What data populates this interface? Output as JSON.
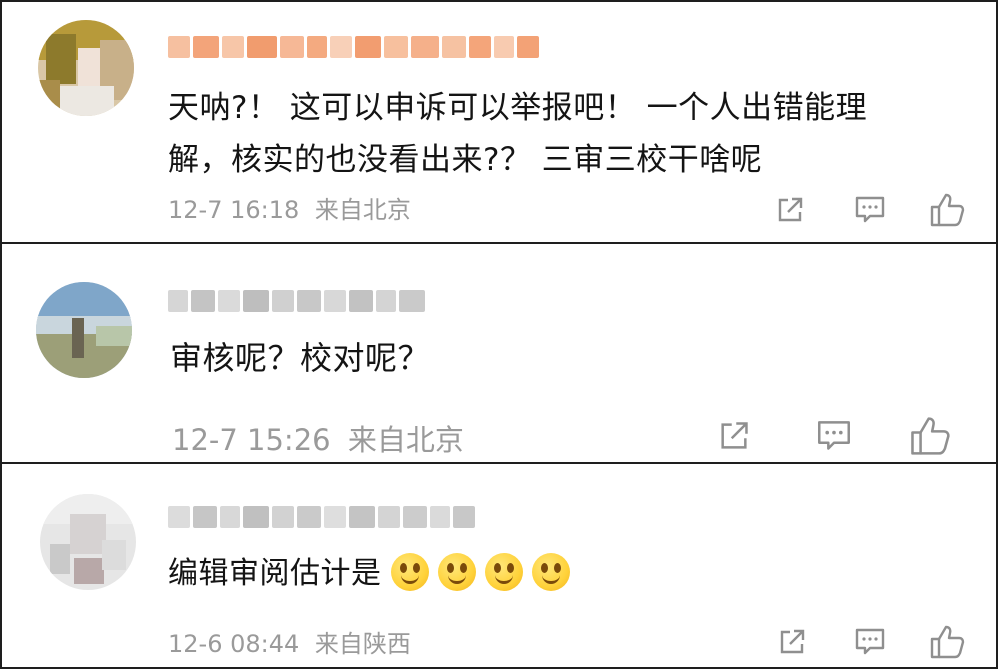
{
  "comments": [
    {
      "text_line1": "天呐?！ 这可以申诉可以举报吧！ 一个人出错能理",
      "text_line2": "解，核实的也没看出来?？ 三审三校干啥呢",
      "time": "12-7 16:18",
      "location": "来自北京",
      "username_style": "orange"
    },
    {
      "text_line1": "审核呢？校对呢？",
      "time": "12-7 15:26",
      "location": "来自北京",
      "username_style": "gray"
    },
    {
      "text_line1": "编辑审阅估计是",
      "emoji": [
        "smile-emoji",
        "smile-emoji",
        "smile-emoji",
        "smile-emoji"
      ],
      "time": "12-6 08:44",
      "location": "来自陕西",
      "username_style": "gray"
    }
  ],
  "icons": {
    "share": "share-icon",
    "comment": "comment-icon",
    "like": "thumbs-up-icon"
  },
  "colors": {
    "username_orange": "#f5a06a",
    "meta_gray": "#9a9a9a",
    "text": "#141414",
    "border": "#1e1e1e"
  }
}
